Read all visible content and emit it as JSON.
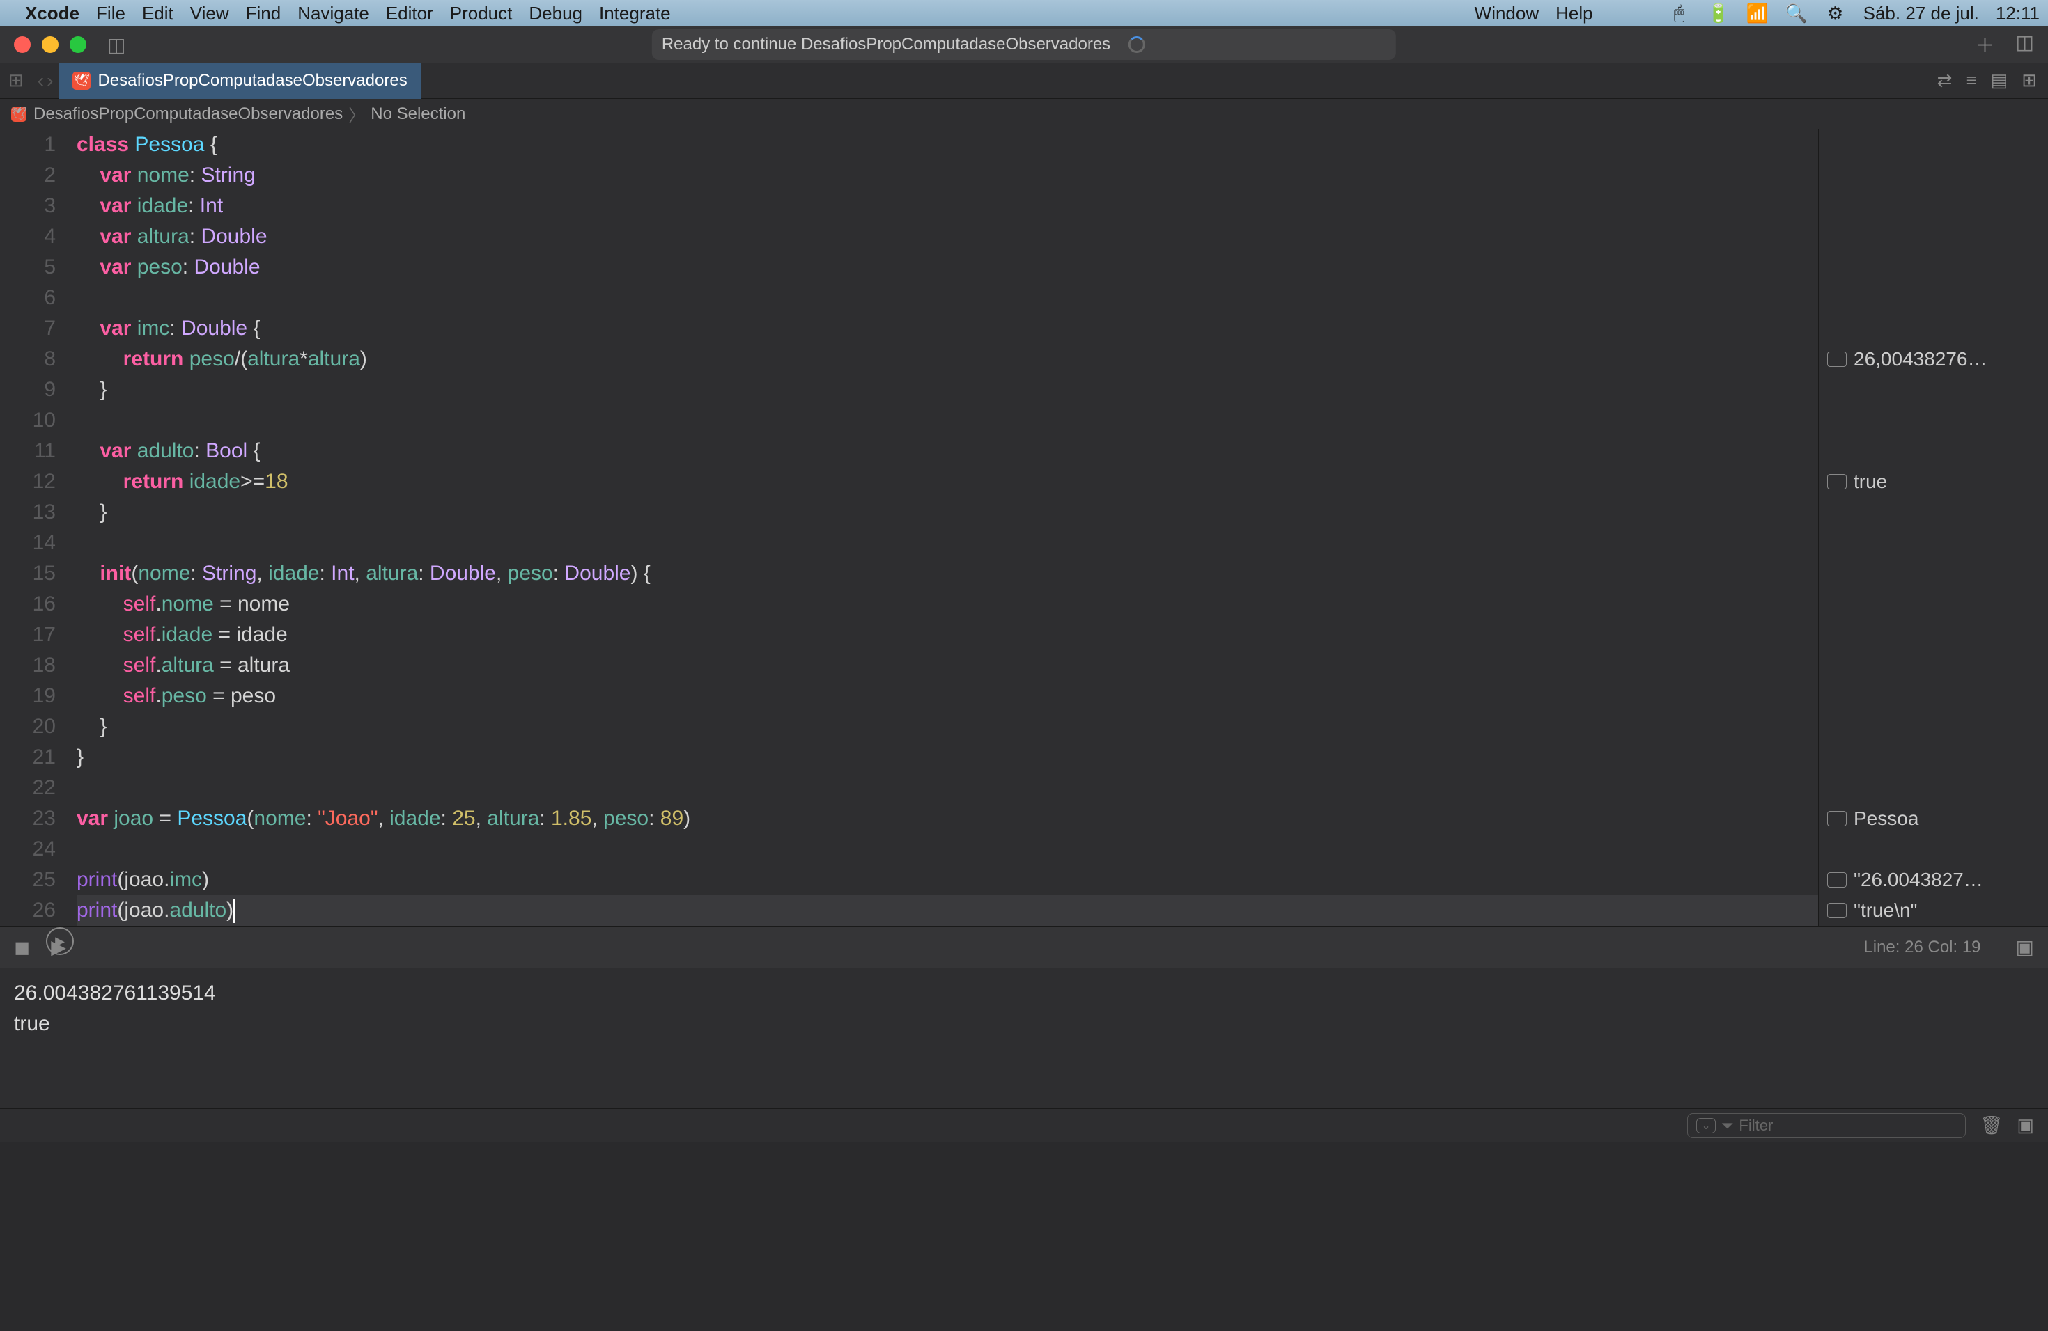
{
  "menubar": {
    "app": "Xcode",
    "items": [
      "File",
      "Edit",
      "View",
      "Find",
      "Navigate",
      "Editor",
      "Product",
      "Debug",
      "Integrate"
    ],
    "right_items": [
      "Window",
      "Help"
    ],
    "date": "Sáb. 27 de jul.",
    "time": "12:11"
  },
  "titlebar": {
    "status": "Ready to continue DesafiosPropComputadaseObservadores"
  },
  "tab": {
    "name": "DesafiosPropComputadaseObservadores"
  },
  "breadcrumb": {
    "project": "DesafiosPropComputadaseObservadores",
    "selection": "No Selection"
  },
  "code": {
    "lines": [
      {
        "n": 1,
        "segs": [
          {
            "t": "class ",
            "c": "kw"
          },
          {
            "t": "Pessoa",
            "c": "type"
          },
          {
            "t": " {",
            "c": "punc"
          }
        ]
      },
      {
        "n": 2,
        "segs": [
          {
            "t": "    var ",
            "c": "kw"
          },
          {
            "t": "nome",
            "c": "prop"
          },
          {
            "t": ": ",
            "c": "punc"
          },
          {
            "t": "String",
            "c": "typekw"
          }
        ]
      },
      {
        "n": 3,
        "segs": [
          {
            "t": "    var ",
            "c": "kw"
          },
          {
            "t": "idade",
            "c": "prop"
          },
          {
            "t": ": ",
            "c": "punc"
          },
          {
            "t": "Int",
            "c": "typekw"
          }
        ]
      },
      {
        "n": 4,
        "segs": [
          {
            "t": "    var ",
            "c": "kw"
          },
          {
            "t": "altura",
            "c": "prop"
          },
          {
            "t": ": ",
            "c": "punc"
          },
          {
            "t": "Double",
            "c": "typekw"
          }
        ]
      },
      {
        "n": 5,
        "segs": [
          {
            "t": "    var ",
            "c": "kw"
          },
          {
            "t": "peso",
            "c": "prop"
          },
          {
            "t": ": ",
            "c": "punc"
          },
          {
            "t": "Double",
            "c": "typekw"
          }
        ]
      },
      {
        "n": 6,
        "segs": [
          {
            "t": "    ",
            "c": "punc"
          }
        ]
      },
      {
        "n": 7,
        "segs": [
          {
            "t": "    var ",
            "c": "kw"
          },
          {
            "t": "imc",
            "c": "prop"
          },
          {
            "t": ": ",
            "c": "punc"
          },
          {
            "t": "Double",
            "c": "typekw"
          },
          {
            "t": " {",
            "c": "punc"
          }
        ]
      },
      {
        "n": 8,
        "segs": [
          {
            "t": "        return ",
            "c": "kw"
          },
          {
            "t": "peso",
            "c": "prop"
          },
          {
            "t": "/(",
            "c": "punc"
          },
          {
            "t": "altura",
            "c": "prop"
          },
          {
            "t": "*",
            "c": "punc"
          },
          {
            "t": "altura",
            "c": "prop"
          },
          {
            "t": ")",
            "c": "punc"
          }
        ]
      },
      {
        "n": 9,
        "segs": [
          {
            "t": "    }",
            "c": "punc"
          }
        ]
      },
      {
        "n": 10,
        "segs": [
          {
            "t": "    ",
            "c": "punc"
          }
        ]
      },
      {
        "n": 11,
        "segs": [
          {
            "t": "    var ",
            "c": "kw"
          },
          {
            "t": "adulto",
            "c": "prop"
          },
          {
            "t": ": ",
            "c": "punc"
          },
          {
            "t": "Bool",
            "c": "typekw"
          },
          {
            "t": " {",
            "c": "punc"
          }
        ]
      },
      {
        "n": 12,
        "segs": [
          {
            "t": "        return ",
            "c": "kw"
          },
          {
            "t": "idade",
            "c": "prop"
          },
          {
            "t": ">=",
            "c": "punc"
          },
          {
            "t": "18",
            "c": "num"
          }
        ]
      },
      {
        "n": 13,
        "segs": [
          {
            "t": "    }",
            "c": "punc"
          }
        ]
      },
      {
        "n": 14,
        "segs": [
          {
            "t": "    ",
            "c": "punc"
          }
        ]
      },
      {
        "n": 15,
        "segs": [
          {
            "t": "    init",
            "c": "kw"
          },
          {
            "t": "(",
            "c": "punc"
          },
          {
            "t": "nome",
            "c": "param"
          },
          {
            "t": ": ",
            "c": "punc"
          },
          {
            "t": "String",
            "c": "typekw"
          },
          {
            "t": ", ",
            "c": "punc"
          },
          {
            "t": "idade",
            "c": "param"
          },
          {
            "t": ": ",
            "c": "punc"
          },
          {
            "t": "Int",
            "c": "typekw"
          },
          {
            "t": ", ",
            "c": "punc"
          },
          {
            "t": "altura",
            "c": "param"
          },
          {
            "t": ": ",
            "c": "punc"
          },
          {
            "t": "Double",
            "c": "typekw"
          },
          {
            "t": ", ",
            "c": "punc"
          },
          {
            "t": "peso",
            "c": "param"
          },
          {
            "t": ": ",
            "c": "punc"
          },
          {
            "t": "Double",
            "c": "typekw"
          },
          {
            "t": ") {",
            "c": "punc"
          }
        ]
      },
      {
        "n": 16,
        "segs": [
          {
            "t": "        self",
            "c": "slf"
          },
          {
            "t": ".",
            "c": "punc"
          },
          {
            "t": "nome",
            "c": "prop"
          },
          {
            "t": " = nome",
            "c": "punc"
          }
        ]
      },
      {
        "n": 17,
        "segs": [
          {
            "t": "        self",
            "c": "slf"
          },
          {
            "t": ".",
            "c": "punc"
          },
          {
            "t": "idade",
            "c": "prop"
          },
          {
            "t": " = idade",
            "c": "punc"
          }
        ]
      },
      {
        "n": 18,
        "segs": [
          {
            "t": "        self",
            "c": "slf"
          },
          {
            "t": ".",
            "c": "punc"
          },
          {
            "t": "altura",
            "c": "prop"
          },
          {
            "t": " = altura",
            "c": "punc"
          }
        ]
      },
      {
        "n": 19,
        "segs": [
          {
            "t": "        self",
            "c": "slf"
          },
          {
            "t": ".",
            "c": "punc"
          },
          {
            "t": "peso",
            "c": "prop"
          },
          {
            "t": " = peso",
            "c": "punc"
          }
        ]
      },
      {
        "n": 20,
        "segs": [
          {
            "t": "    }",
            "c": "punc"
          }
        ]
      },
      {
        "n": 21,
        "segs": [
          {
            "t": "}",
            "c": "punc"
          }
        ]
      },
      {
        "n": 22,
        "segs": [
          {
            "t": "",
            "c": "punc"
          }
        ]
      },
      {
        "n": 23,
        "segs": [
          {
            "t": "var ",
            "c": "kw"
          },
          {
            "t": "joao",
            "c": "prop"
          },
          {
            "t": " = ",
            "c": "punc"
          },
          {
            "t": "Pessoa",
            "c": "type"
          },
          {
            "t": "(",
            "c": "punc"
          },
          {
            "t": "nome",
            "c": "param"
          },
          {
            "t": ": ",
            "c": "punc"
          },
          {
            "t": "\"Joao\"",
            "c": "str"
          },
          {
            "t": ", ",
            "c": "punc"
          },
          {
            "t": "idade",
            "c": "param"
          },
          {
            "t": ": ",
            "c": "punc"
          },
          {
            "t": "25",
            "c": "num"
          },
          {
            "t": ", ",
            "c": "punc"
          },
          {
            "t": "altura",
            "c": "param"
          },
          {
            "t": ": ",
            "c": "punc"
          },
          {
            "t": "1.85",
            "c": "num"
          },
          {
            "t": ", ",
            "c": "punc"
          },
          {
            "t": "peso",
            "c": "param"
          },
          {
            "t": ": ",
            "c": "punc"
          },
          {
            "t": "89",
            "c": "num"
          },
          {
            "t": ")",
            "c": "punc"
          }
        ]
      },
      {
        "n": 24,
        "segs": [
          {
            "t": "",
            "c": "punc"
          }
        ]
      },
      {
        "n": 25,
        "segs": [
          {
            "t": "print",
            "c": "fn"
          },
          {
            "t": "(joao.",
            "c": "punc"
          },
          {
            "t": "imc",
            "c": "prop"
          },
          {
            "t": ")",
            "c": "punc"
          }
        ]
      },
      {
        "n": 26,
        "segs": [
          {
            "t": "print",
            "c": "fn"
          },
          {
            "t": "(joao.",
            "c": "punc"
          },
          {
            "t": "adulto",
            "c": "prop"
          },
          {
            "t": ")",
            "c": "punc"
          }
        ],
        "current": true
      }
    ]
  },
  "results": [
    {
      "line": 8,
      "text": "26,00438276…"
    },
    {
      "line": 12,
      "text": "true"
    },
    {
      "line": 23,
      "text": "Pessoa"
    },
    {
      "line": 25,
      "text": "\"26.0043827…"
    },
    {
      "line": 26,
      "text": "\"true\\n\""
    }
  ],
  "runbar": {
    "status": "Line: 26  Col: 19"
  },
  "console": {
    "lines": [
      "26.004382761139514",
      "true"
    ]
  },
  "filter": {
    "placeholder": "Filter"
  }
}
